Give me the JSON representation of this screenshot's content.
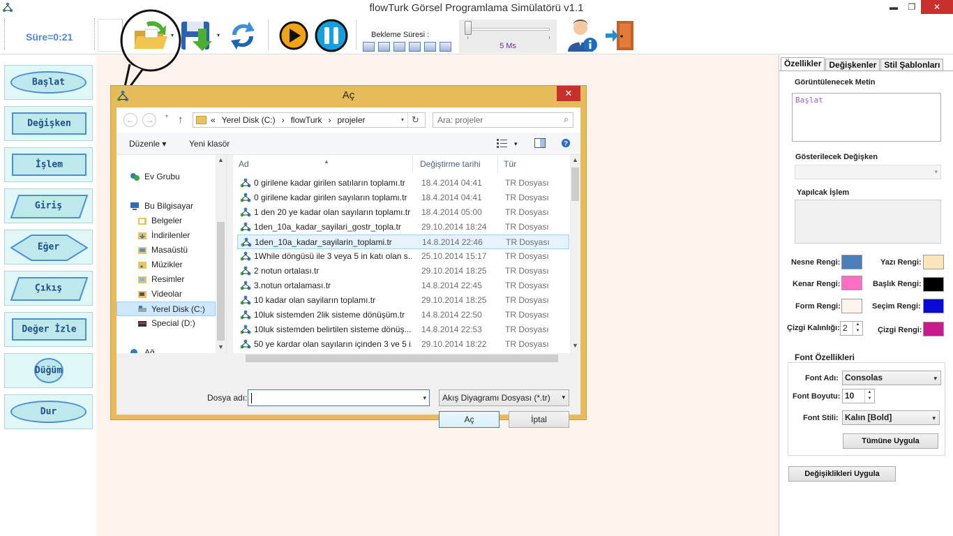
{
  "window": {
    "title": "flowTurk Görsel Programlama Simülatörü v1.1",
    "minimize": "▬",
    "maximize": "❐",
    "close": "✕"
  },
  "toolbar": {
    "timer": "Süre=0:21",
    "wait_label": "Bekleme Süresi :",
    "wait_value": "5 Ms",
    "dropdown_arrow": "▾"
  },
  "palette": [
    {
      "label": "Başlat"
    },
    {
      "label": "Değişken"
    },
    {
      "label": "İşlem"
    },
    {
      "label": "Giriş"
    },
    {
      "label": "Eğer"
    },
    {
      "label": "Çıkış"
    },
    {
      "label": "Değer İzle"
    },
    {
      "label": "Düğüm"
    },
    {
      "label": "Dur"
    }
  ],
  "dialog": {
    "title": "Aç",
    "close": "✕",
    "back": "←",
    "forward": "→",
    "up": "↑",
    "nav_drop": "▾",
    "address": [
      "«",
      "Yerel Disk (C:)",
      "›",
      "flowTurk",
      "›",
      "projeler"
    ],
    "address_drop": "▾",
    "refresh": "↻",
    "search_placeholder": "Ara: projeler",
    "search_icon": "⌕",
    "organize": "Düzenle ▾",
    "new_folder": "Yeni klasör",
    "nav": [
      {
        "label": "Ev Grubu",
        "icon": "homegroup-icon"
      },
      {
        "label": "Bu Bilgisayar",
        "icon": "computer-icon"
      },
      {
        "label": "Belgeler",
        "icon": "folder-icon"
      },
      {
        "label": "İndirilenler",
        "icon": "folder-icon"
      },
      {
        "label": "Masaüstü",
        "icon": "folder-icon"
      },
      {
        "label": "Müzikler",
        "icon": "folder-icon"
      },
      {
        "label": "Resimler",
        "icon": "folder-icon"
      },
      {
        "label": "Videolar",
        "icon": "folder-icon"
      },
      {
        "label": "Yerel Disk (C:)",
        "icon": "drive-icon"
      },
      {
        "label": "Special (D:)",
        "icon": "drive-icon"
      },
      {
        "label": "Ağ",
        "icon": "network-icon"
      }
    ],
    "columns": [
      "Ad",
      "Değiştirme tarihi",
      "Tür"
    ],
    "files": [
      {
        "name": "0 girilene kadar girilen satıların toplamı.tr",
        "date": "18.4.2014 04:41",
        "type": "TR Dosyası"
      },
      {
        "name": "0 girilene kadar girilen sayıların toplamı.tr",
        "date": "18.4.2014 04:41",
        "type": "TR Dosyası"
      },
      {
        "name": "1 den 20 ye kadar olan sayıların toplamı.tr",
        "date": "18.4.2014 05:00",
        "type": "TR Dosyası"
      },
      {
        "name": "1den_10a_kadar_sayilari_gostr_topla.tr",
        "date": "29.10.2014 18:24",
        "type": "TR Dosyası"
      },
      {
        "name": "1den_10a_kadar_sayilarin_toplami.tr",
        "date": "14.8.2014 22:46",
        "type": "TR Dosyası"
      },
      {
        "name": "1While döngüsü ile 3 veya 5 in katı olan s...",
        "date": "25.10.2014 15:17",
        "type": "TR Dosyası"
      },
      {
        "name": "2 notun ortalası.tr",
        "date": "29.10.2014 18:25",
        "type": "TR Dosyası"
      },
      {
        "name": "3.notun  ortalaması.tr",
        "date": "14.8.2014 22:45",
        "type": "TR Dosyası"
      },
      {
        "name": "10 kadar olan sayiların toplamı.tr",
        "date": "29.10.2014 18:25",
        "type": "TR Dosyası"
      },
      {
        "name": "10luk sistemden 2lik sisteme dönüşüm.tr",
        "date": "14.8.2014 22:50",
        "type": "TR Dosyası"
      },
      {
        "name": "10luk sistemden belirtilen sisteme dönüş...",
        "date": "14.8.2014 22:53",
        "type": "TR Dosyası"
      },
      {
        "name": "50 ye kardar olan sayıların içinden 3 ve 5 i...",
        "date": "29.10.2014 18:22",
        "type": "TR Dosyası"
      }
    ],
    "selected_file_index": 4,
    "file_name_label": "Dosya adı:",
    "file_name_value": "",
    "file_type": "Akış Diyagramı Dosyası (*.tr)",
    "combo_drop": "▾",
    "open_button": "Aç",
    "cancel_button": "İptal",
    "scroll_up": "▲",
    "scroll_down": "▼",
    "scroll_left": "◀",
    "scroll_right": "▶"
  },
  "properties": {
    "tabs": [
      "Özellikler",
      "Değişkenler",
      "Stil Şablonları"
    ],
    "display_text_label": "Görüntülenecek Metin",
    "display_text_value": "Başlat",
    "variable_label": "Gösterilecek Değişken",
    "operation_label": "Yapılcak İşlem",
    "object_color_label": "Nesne Rengi:",
    "text_color_label": "Yazı Rengi:",
    "border_color_label": "Kenar Rengi:",
    "title_color_label": "Başlık Rengi:",
    "form_color_label": "Form Rengi:",
    "selection_color_label": "Seçim Rengi:",
    "line_width_label": "Çizgi Kalınlığı:",
    "line_width_value": "2",
    "line_color_label": "Çizgi Rengi:",
    "font_group_label": "Font Özellikleri",
    "font_name_label": "Font Adı:",
    "font_name_value": "Consolas",
    "font_size_label": "Font Boyutu:",
    "font_size_value": "10",
    "font_style_label": "Font Stili:",
    "font_style_value": "Kalın [Bold]",
    "apply_all_button": "Tümüne Uygula",
    "apply_changes_button": "Değişiklikleri Uygula",
    "spin_arrows": "▲▼",
    "combo_drop": "▾"
  },
  "colors": {
    "object": "#4a7fb8",
    "text": "#fde4bc",
    "border": "#ff6ec4",
    "title": "#000000",
    "form": "#fdf3ec",
    "selection": "#0a0ad6",
    "line": "#c81c8c"
  }
}
